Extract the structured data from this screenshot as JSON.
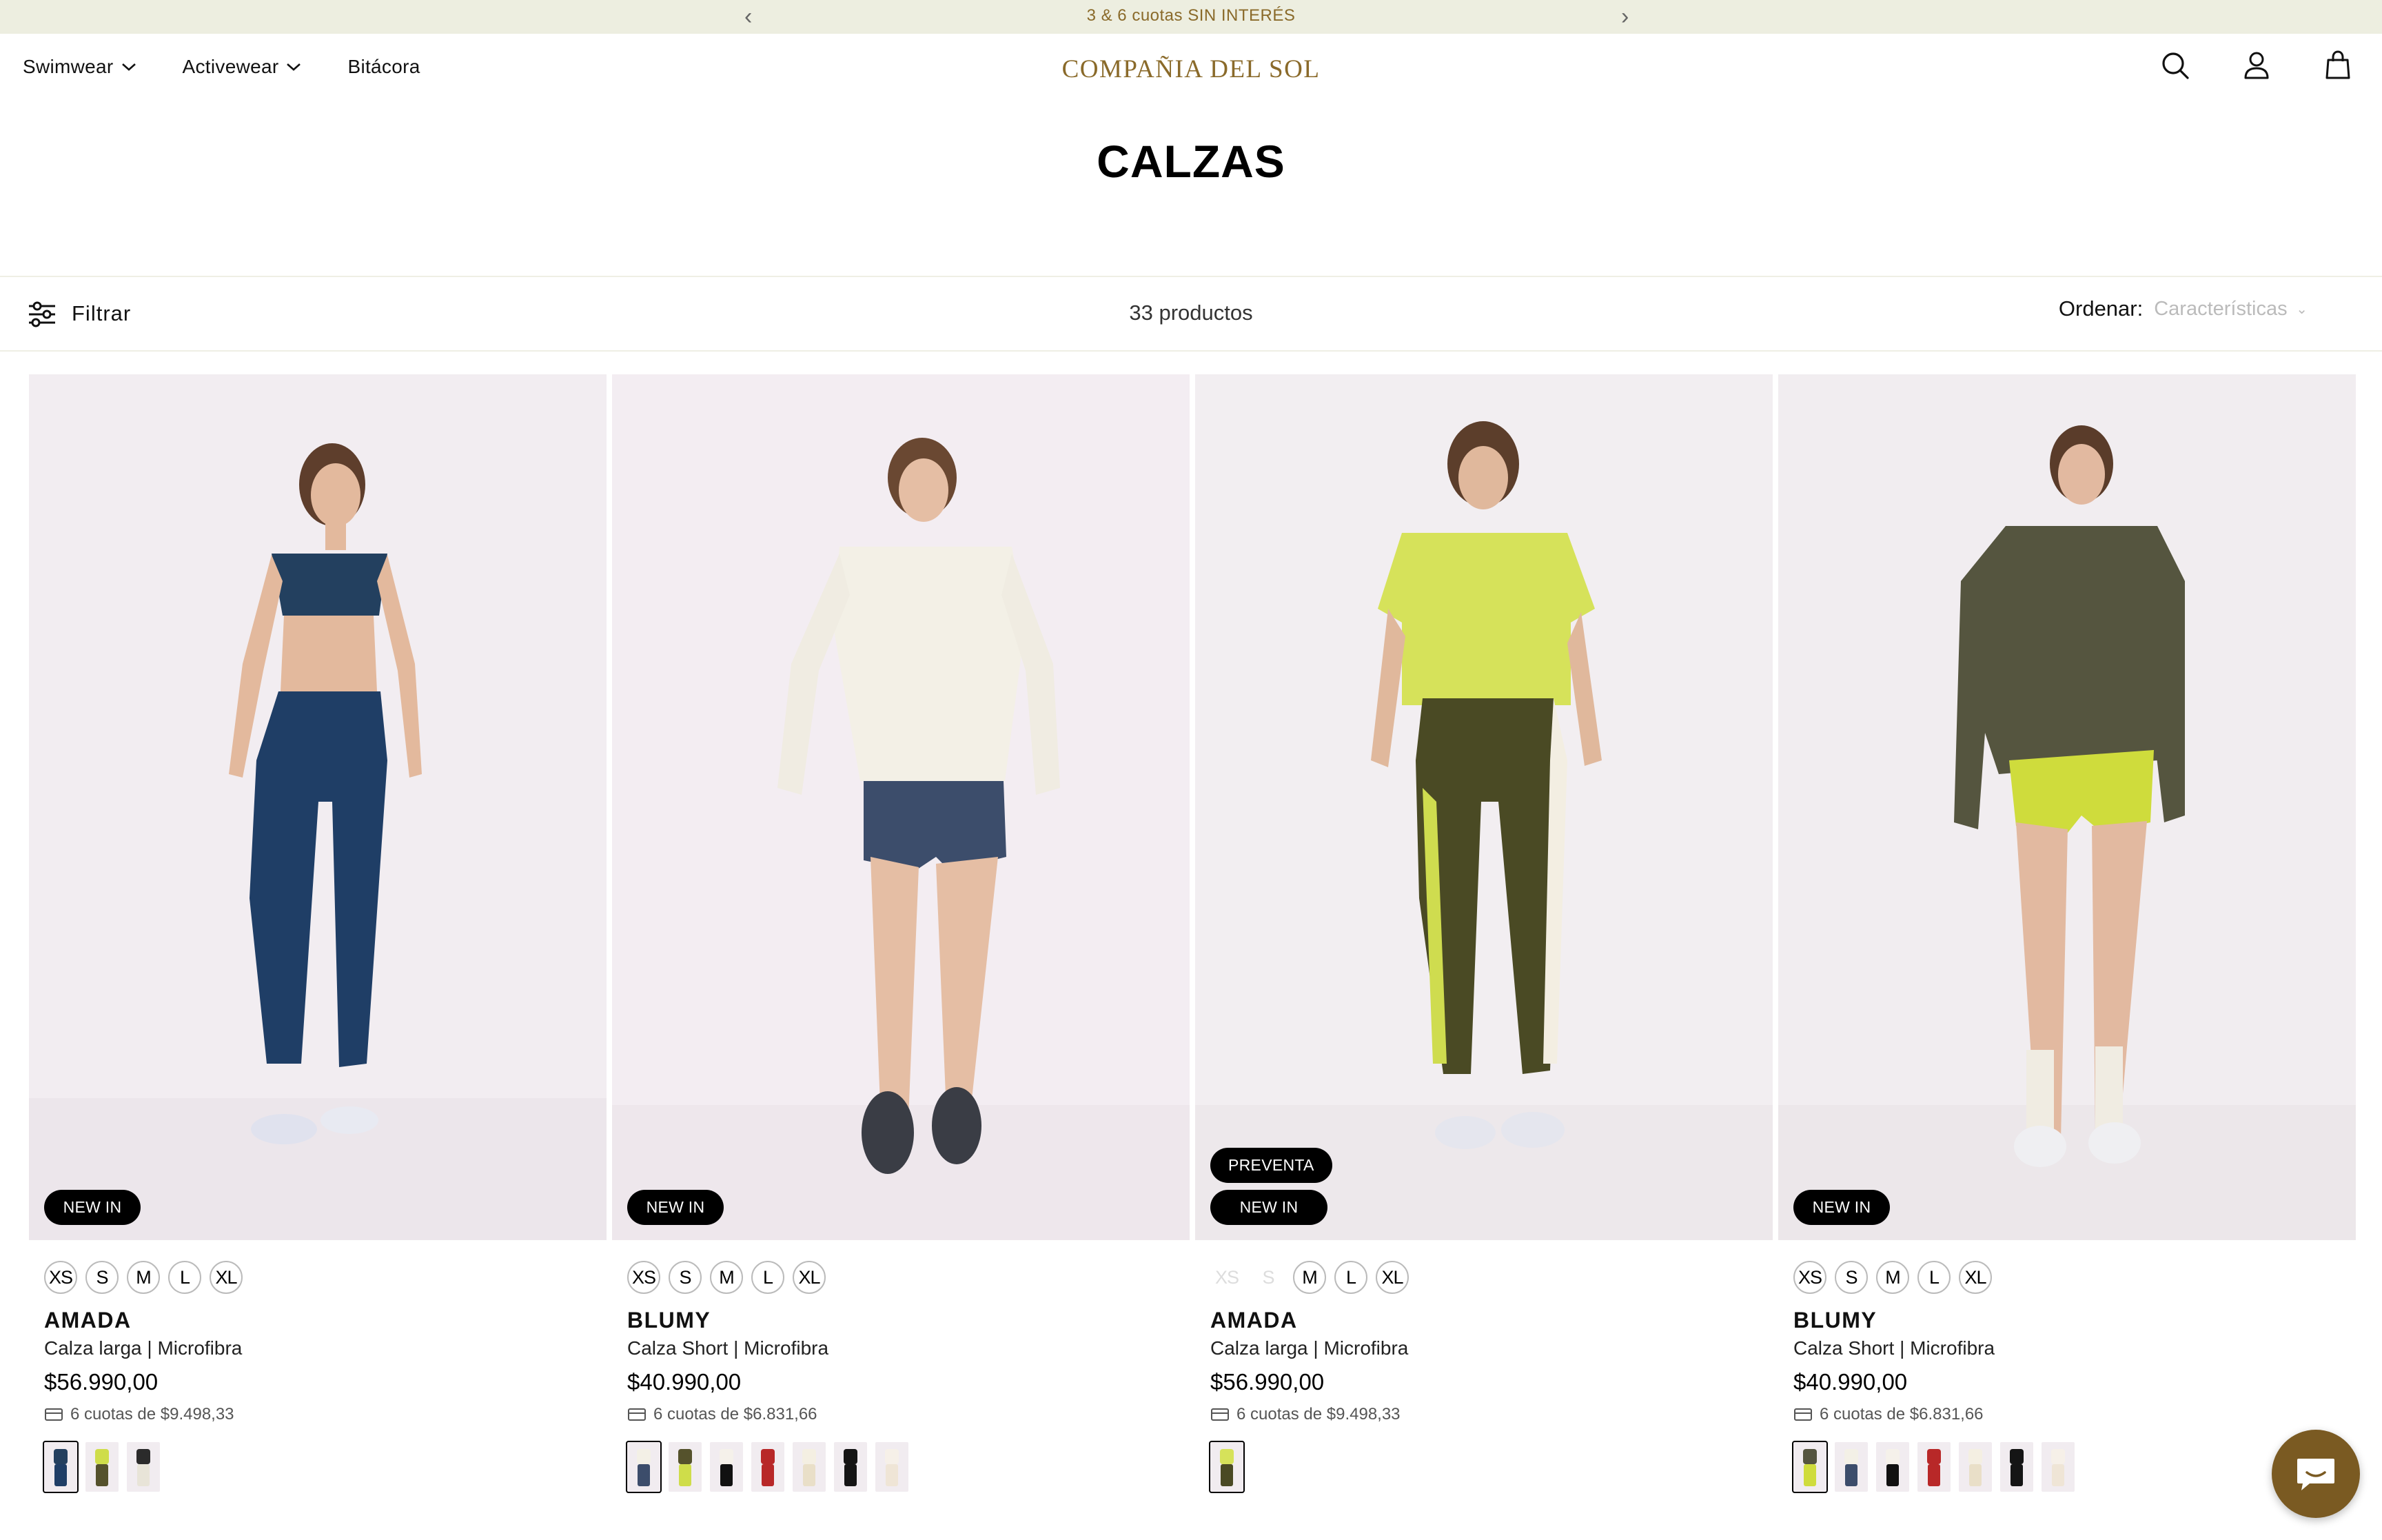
{
  "announcement": {
    "message": "3 & 6 cuotas SIN INTERÉS",
    "prev_icon": "chevron-left-icon",
    "next_icon": "chevron-right-icon"
  },
  "header": {
    "nav": [
      {
        "label": "Swimwear",
        "has_dropdown": true
      },
      {
        "label": "Activewear",
        "has_dropdown": true
      },
      {
        "label": "Bitácora",
        "has_dropdown": false
      }
    ],
    "logo": "COMPAÑIA DEL SOL",
    "icons": [
      "search-icon",
      "account-icon",
      "cart-icon"
    ]
  },
  "page": {
    "title": "CALZAS"
  },
  "toolbar": {
    "filter_label": "Filtrar",
    "product_count": "33 productos",
    "sort_label": "Ordenar:",
    "sort_value": "Características"
  },
  "colors": {
    "brand": "#8a6a2a",
    "announce_bg": "#edeee0",
    "chat_bg": "#7a5a22"
  },
  "products": [
    {
      "name": "AMADA",
      "description": "Calza larga | Microfibra",
      "price": "$56.990,00",
      "installments": "6 cuotas de $9.498,33",
      "badges": [
        "NEW IN"
      ],
      "sizes": [
        "XS",
        "S",
        "M",
        "L",
        "XL"
      ],
      "sizes_available": [
        true,
        true,
        true,
        true,
        true
      ],
      "swatch_count": 3
    },
    {
      "name": "BLUMY",
      "description": "Calza Short | Microfibra",
      "price": "$40.990,00",
      "installments": "6 cuotas de $6.831,66",
      "badges": [
        "NEW IN"
      ],
      "sizes": [
        "XS",
        "S",
        "M",
        "L",
        "XL"
      ],
      "sizes_available": [
        true,
        true,
        true,
        true,
        true
      ],
      "swatch_count": 7
    },
    {
      "name": "AMADA",
      "description": "Calza larga | Microfibra",
      "price": "$56.990,00",
      "installments": "6 cuotas de $9.498,33",
      "badges": [
        "PREVENTA",
        "NEW IN"
      ],
      "sizes": [
        "XS",
        "S",
        "M",
        "L",
        "XL"
      ],
      "sizes_available": [
        false,
        false,
        true,
        true,
        true
      ],
      "swatch_count": 1
    },
    {
      "name": "BLUMY",
      "description": "Calza Short | Microfibra",
      "price": "$40.990,00",
      "installments": "6 cuotas de $6.831,66",
      "badges": [
        "NEW IN"
      ],
      "sizes": [
        "XS",
        "S",
        "M",
        "L",
        "XL"
      ],
      "sizes_available": [
        true,
        true,
        true,
        true,
        true
      ],
      "swatch_count": 7
    }
  ],
  "chat": {
    "icon": "chat-icon"
  }
}
